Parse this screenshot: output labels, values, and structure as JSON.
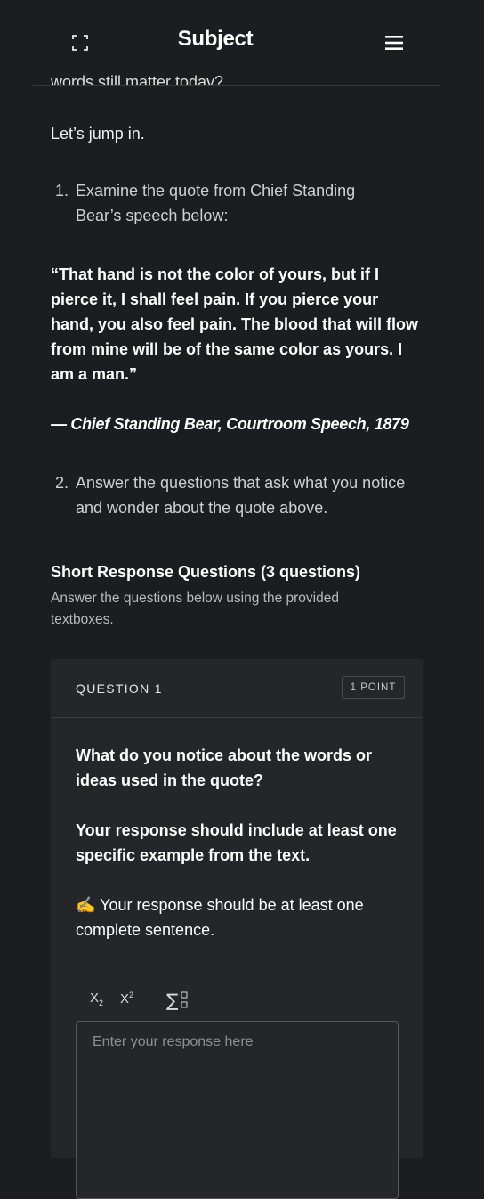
{
  "header": {
    "title": "Subject",
    "expand_icon": "expand-icon",
    "menu_icon": "hamburger-menu-icon"
  },
  "clipped_text": "words still matter today?",
  "intro": "Let’s jump in.",
  "steps": [
    {
      "num": "1.",
      "text": "Examine the quote from Chief Standing Bear’s speech below:"
    },
    {
      "num": "2.",
      "text": "Answer the questions that ask what you notice and wonder about the quote above."
    }
  ],
  "quote": {
    "text": "“That hand is not the color of yours, but if I pierce it, I shall feel pain. If you pierce your hand, you also feel pain. The blood that will flow from mine will be of the same color as yours. I am a man.”",
    "citation": "— Chief Standing Bear, Courtroom Speech, 1879"
  },
  "short_response": {
    "title": "Short Response Questions (3 questions)",
    "subtitle": "Answer the questions below using the provided textboxes."
  },
  "question": {
    "label": "QUESTION 1",
    "points": "1 POINT",
    "prompt": "What do you notice about the words or ideas used in the quote?",
    "requirement": "Your response should include at least one specific example from the text.",
    "note_emoji": "✍️",
    "note": "Your response should be at least one complete sentence.",
    "toolbar": {
      "subscript": "X",
      "subscript_mark": "2",
      "superscript": "X",
      "superscript_mark": "2",
      "equation_icon": "sigma-icon"
    },
    "response_placeholder": "Enter your response here"
  },
  "colors": {
    "background": "#1c1d20",
    "card": "#25262a",
    "border": "#3a3b40"
  }
}
